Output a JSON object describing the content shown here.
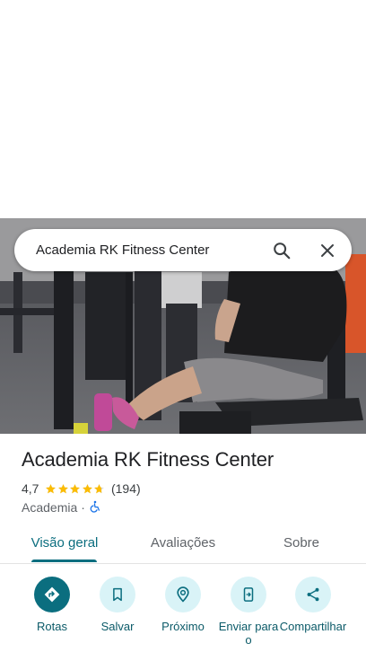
{
  "search": {
    "query": "Academia RK Fitness Center",
    "search_icon": "search-icon",
    "close_icon": "close-icon"
  },
  "place": {
    "name": "Academia RK Fitness Center",
    "rating": "4,7",
    "rating_value": 4.7,
    "rating_max": 5,
    "review_count": "(194)",
    "category": "Academia",
    "separator": "·",
    "accessibility_icon": "wheelchair-icon"
  },
  "tabs": [
    {
      "label": "Visão geral",
      "active": true
    },
    {
      "label": "Avaliações",
      "active": false
    },
    {
      "label": "Sobre",
      "active": false
    }
  ],
  "actions": [
    {
      "label": "Rotas",
      "icon": "directions-icon"
    },
    {
      "label": "Salvar",
      "icon": "bookmark-icon"
    },
    {
      "label": "Próximo",
      "icon": "nearby-icon"
    },
    {
      "label": "Enviar para o",
      "icon": "send-to-phone-icon"
    },
    {
      "label": "Compartilhar",
      "icon": "share-icon"
    }
  ],
  "colors": {
    "accent": "#0b6e7f",
    "accent_light": "#d9f3f7",
    "star": "#fbbc04",
    "accessibility": "#1a73e8"
  }
}
